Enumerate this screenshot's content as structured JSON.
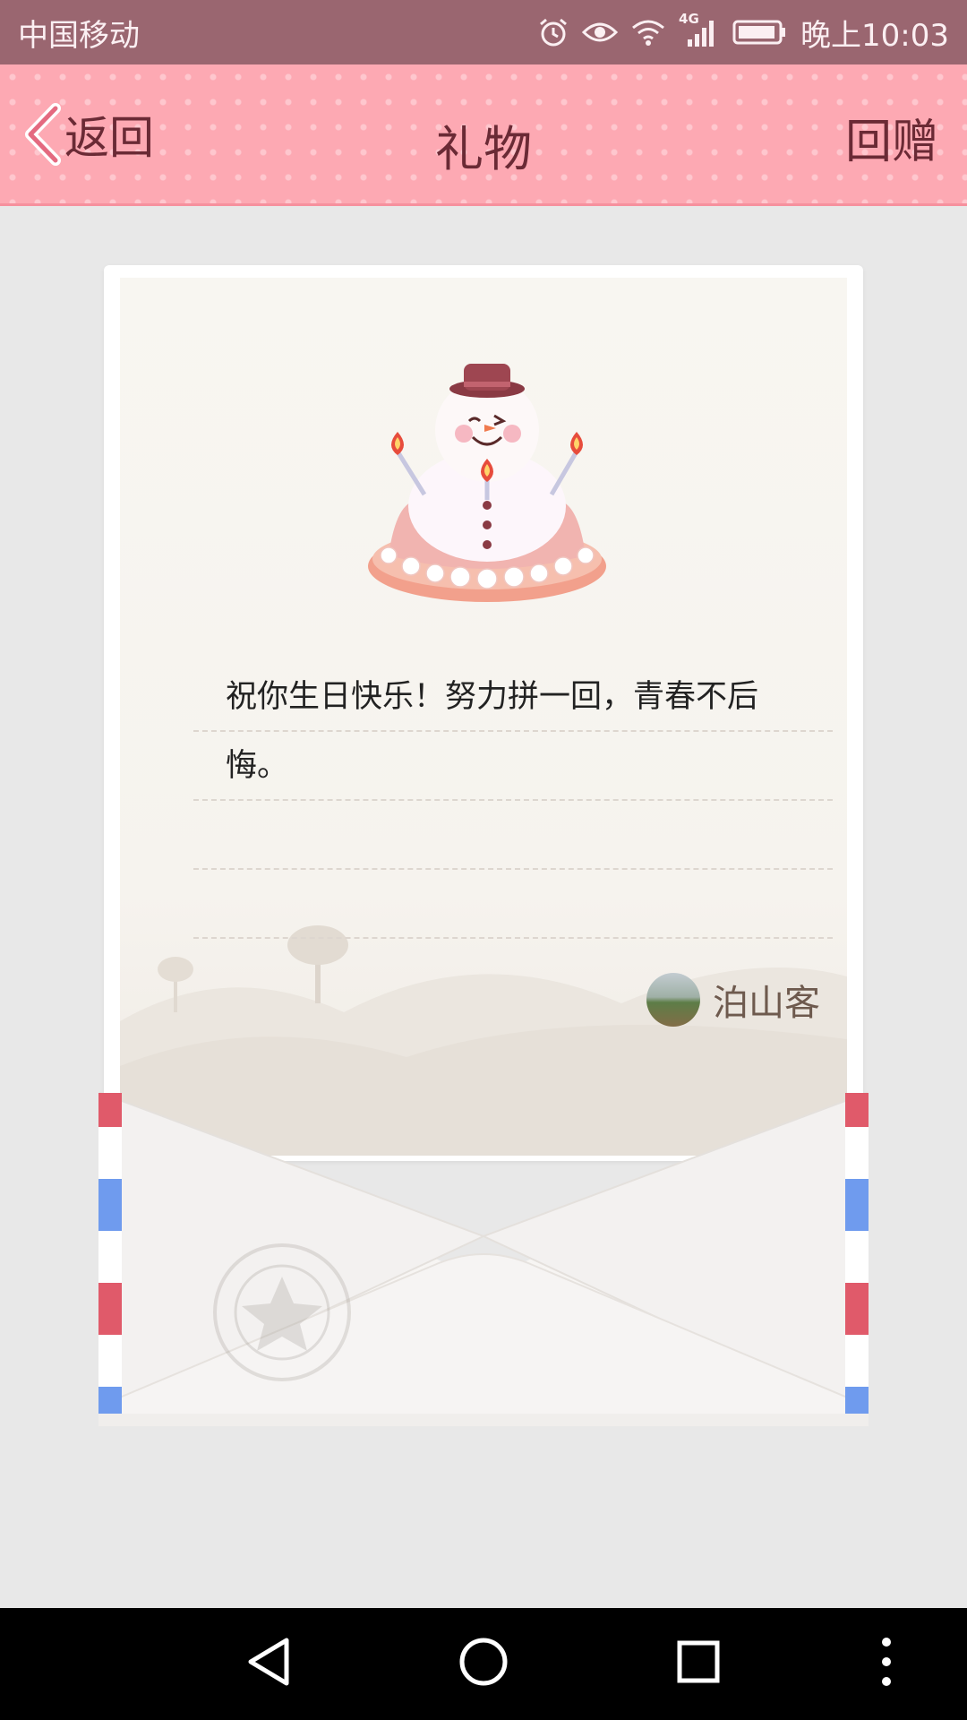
{
  "status_bar": {
    "carrier": "中国移动",
    "network": "4G",
    "time": "晚上10:03"
  },
  "header": {
    "back_label": "返回",
    "title": "礼物",
    "reply_label": "回赠"
  },
  "letter": {
    "message_lines": [
      "祝你生日快乐！努力拼一回，青春不后",
      "悔。",
      "",
      ""
    ],
    "sender_name": "泊山客"
  },
  "colors": {
    "status_bar_bg": "#9a6670",
    "header_bg": "#fda9b3",
    "header_text": "#6a2a35",
    "page_bg": "#e8e8e8"
  },
  "icons": {
    "status": [
      "alarm-icon",
      "eye-icon",
      "wifi-icon",
      "signal-icon",
      "battery-icon"
    ],
    "nav": [
      "back-triangle-icon",
      "home-circle-icon",
      "recents-square-icon",
      "more-dots-icon"
    ]
  }
}
